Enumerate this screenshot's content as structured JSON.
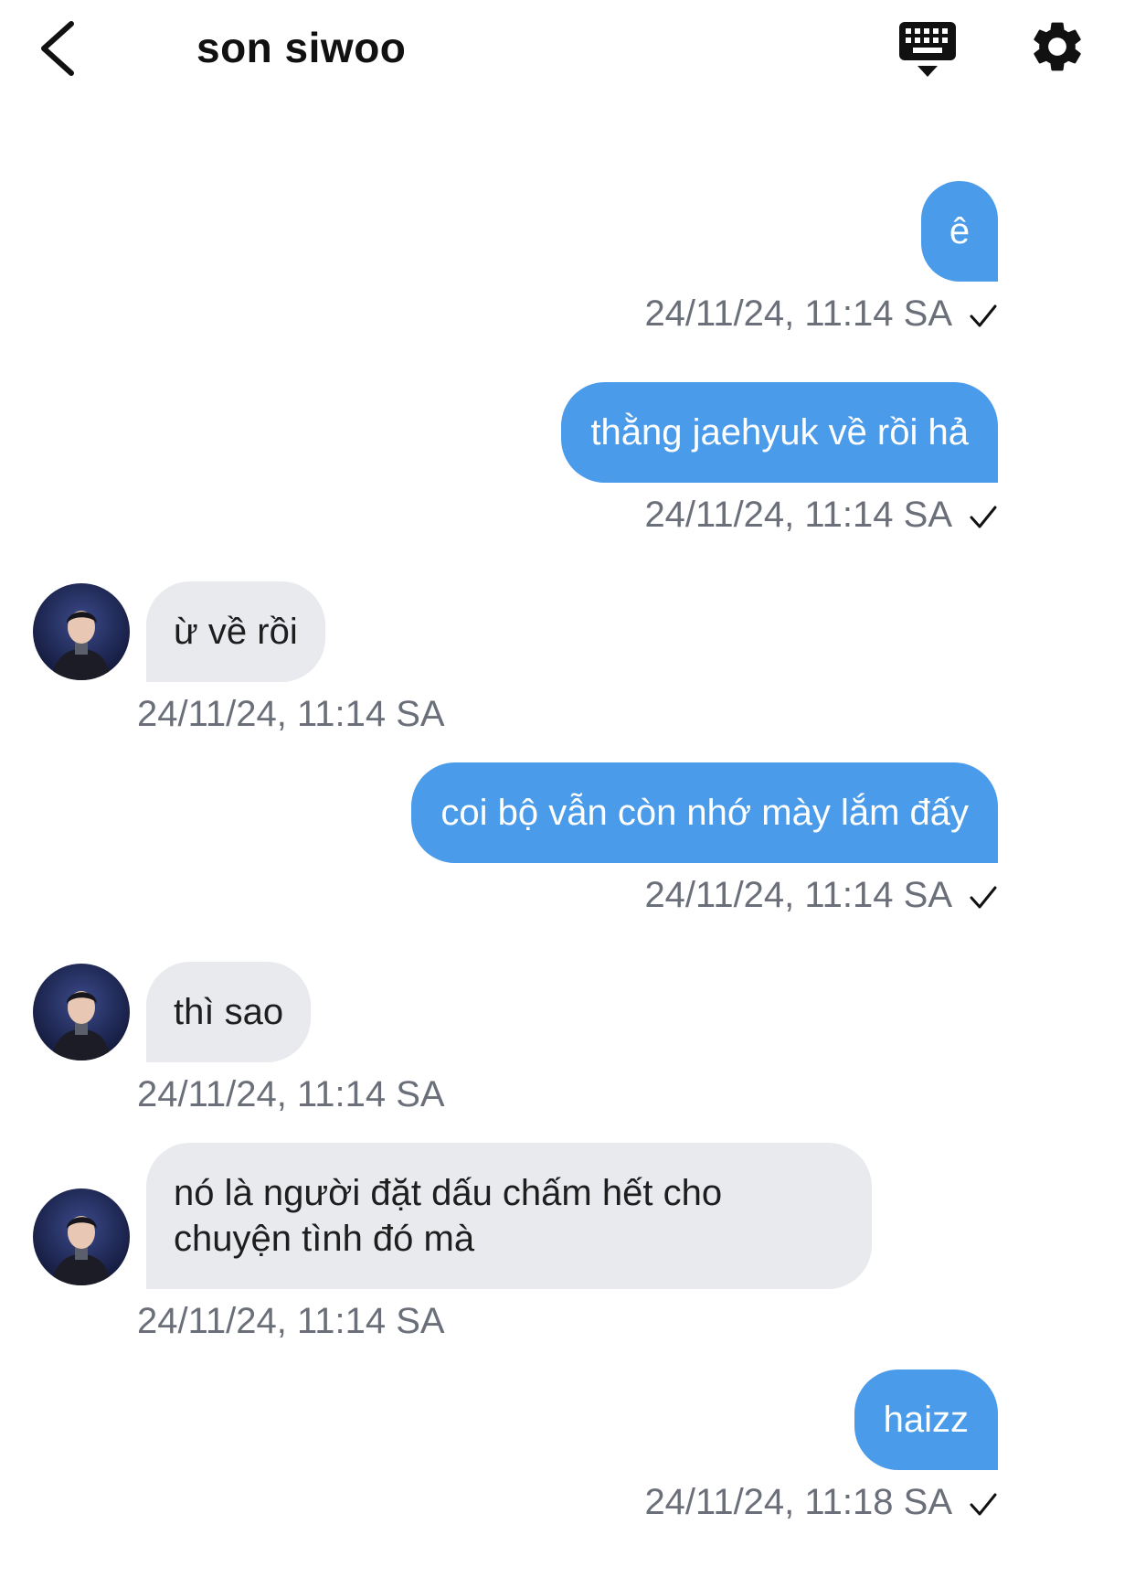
{
  "header": {
    "title": "son siwoo",
    "back_icon": "chevron-left-icon",
    "keyboard_icon": "keyboard-icon",
    "settings_icon": "gear-icon"
  },
  "colors": {
    "outgoing_bubble": "#4a9be9",
    "incoming_bubble": "#e8eaee",
    "timestamp": "#6a6f79"
  },
  "messages": [
    {
      "direction": "out",
      "text": "ê",
      "time": "24/11/24, 11:14 SA",
      "read_icon": "checkmark-icon"
    },
    {
      "direction": "out",
      "text": "thằng jaehyuk về rồi hả",
      "time": "24/11/24, 11:14 SA",
      "read_icon": "checkmark-icon"
    },
    {
      "direction": "in",
      "text": "ừ về rồi",
      "time": "24/11/24, 11:14 SA"
    },
    {
      "direction": "out",
      "text": "coi bộ vẫn còn nhớ mày lắm đấy",
      "time": "24/11/24, 11:14 SA",
      "read_icon": "checkmark-icon"
    },
    {
      "direction": "in",
      "text": "thì sao",
      "time": "24/11/24, 11:14 SA"
    },
    {
      "direction": "in",
      "text": "nó là người đặt dấu chấm hết cho chuyện tình đó mà",
      "time": "24/11/24, 11:14 SA"
    },
    {
      "direction": "out",
      "text": "haizz",
      "time": "24/11/24, 11:18 SA",
      "read_icon": "checkmark-icon"
    }
  ]
}
